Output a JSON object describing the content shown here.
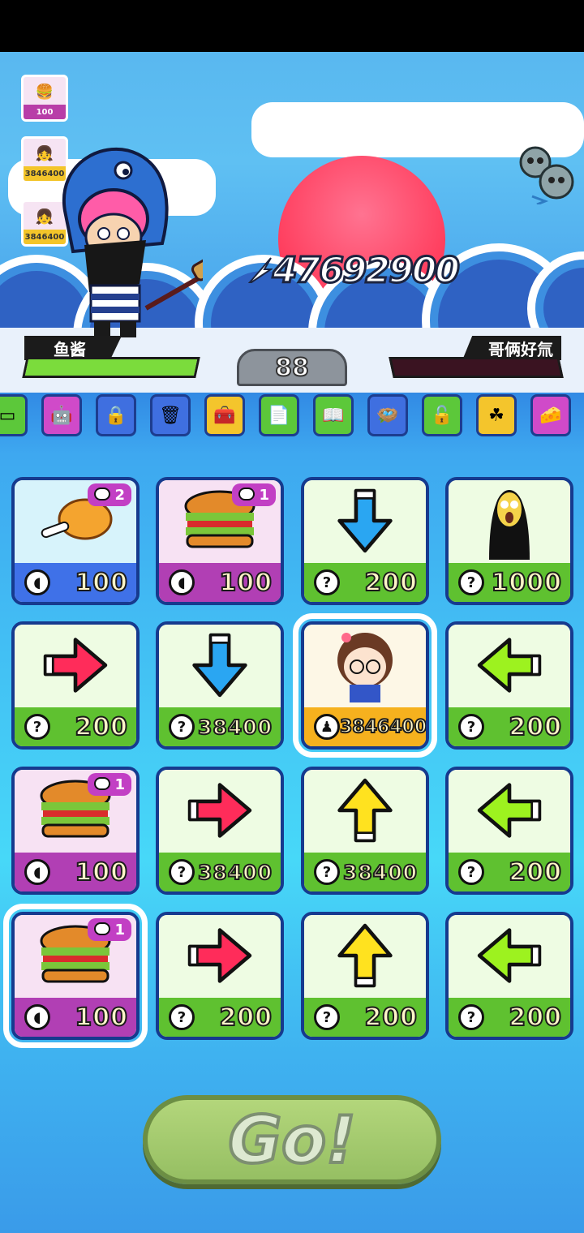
{
  "battle": {
    "score": "47692900",
    "timer": "88",
    "player1": {
      "name": "鱼酱",
      "hp": 1.0
    },
    "player2": {
      "name": "哥俩好氚",
      "hp": 0.0
    }
  },
  "sidebar": [
    {
      "icon": "burger-icon",
      "label": "100"
    },
    {
      "icon": "avatar-icon",
      "label": "3846400"
    },
    {
      "icon": "avatar-icon",
      "label": "3846400"
    }
  ],
  "tray": [
    {
      "icon": "device-icon",
      "color": "#5cc83a"
    },
    {
      "icon": "robot-icon",
      "color": "#d04ac9"
    },
    {
      "icon": "safe-icon",
      "color": "#3f6fe0"
    },
    {
      "icon": "trash-can-icon",
      "color": "#3f6fe0"
    },
    {
      "icon": "treasure-box-icon",
      "color": "#f4c52c"
    },
    {
      "icon": "document-icon",
      "color": "#5cc83a"
    },
    {
      "icon": "book-icon",
      "color": "#5cc83a"
    },
    {
      "icon": "nest-icon",
      "color": "#3f6fe0"
    },
    {
      "icon": "lock-icon",
      "color": "#5cc83a"
    },
    {
      "icon": "clover-icon",
      "color": "#f4c52c"
    },
    {
      "icon": "cheese-icon",
      "color": "#d04ac9"
    }
  ],
  "cards": [
    {
      "item": "drumstick-icon",
      "price": "100",
      "price_icon": "bread-icon",
      "theme": "blue",
      "face": "#d7f3fb",
      "badge": "2"
    },
    {
      "item": "burger-icon",
      "price": "100",
      "price_icon": "bread-icon",
      "theme": "magenta",
      "face": "#f7e2f3",
      "badge": "1"
    },
    {
      "item": "arrow-down-icon",
      "price": "200",
      "price_icon": "question-icon",
      "theme": "green",
      "face": "#eefce3"
    },
    {
      "item": "scream-icon",
      "price": "1000",
      "price_icon": "question-icon",
      "theme": "green",
      "face": "#eefce3"
    },
    {
      "item": "arrow-right-icon",
      "price": "200",
      "price_icon": "question-icon",
      "theme": "green",
      "face": "#eefce3"
    },
    {
      "item": "arrow-down-icon",
      "price": "38400",
      "price_icon": "question-icon",
      "theme": "green",
      "face": "#eefce3"
    },
    {
      "item": "avatar-icon",
      "price": "3846400",
      "price_icon": "person-icon",
      "theme": "orange",
      "face": "#fdf7e6",
      "selected": true
    },
    {
      "item": "arrow-left-icon",
      "price": "200",
      "price_icon": "question-icon",
      "theme": "green",
      "face": "#eefce3"
    },
    {
      "item": "burger-icon",
      "price": "100",
      "price_icon": "bread-icon",
      "theme": "magenta",
      "face": "#f7e2f3",
      "badge": "1"
    },
    {
      "item": "arrow-right-icon",
      "price": "38400",
      "price_icon": "question-icon",
      "theme": "green",
      "face": "#eefce3"
    },
    {
      "item": "arrow-up-icon",
      "price": "38400",
      "price_icon": "question-icon",
      "theme": "green",
      "face": "#eefce3"
    },
    {
      "item": "arrow-left-icon",
      "price": "200",
      "price_icon": "question-icon",
      "theme": "green",
      "face": "#eefce3"
    },
    {
      "item": "burger-icon",
      "price": "100",
      "price_icon": "bread-icon",
      "theme": "magenta",
      "face": "#f7e2f3",
      "badge": "1",
      "selected": true
    },
    {
      "item": "arrow-right-icon",
      "price": "200",
      "price_icon": "question-icon",
      "theme": "green",
      "face": "#eefce3"
    },
    {
      "item": "arrow-up-icon",
      "price": "200",
      "price_icon": "question-icon",
      "theme": "green",
      "face": "#eefce3"
    },
    {
      "item": "arrow-left-icon",
      "price": "200",
      "price_icon": "question-icon",
      "theme": "green",
      "face": "#eefce3"
    }
  ],
  "go_button": {
    "label": "Go!"
  }
}
